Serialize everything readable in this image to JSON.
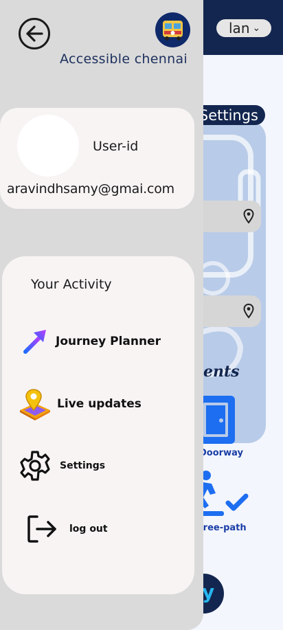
{
  "header": {
    "language_label": "lan",
    "language_chevron": "chevron-down-icon"
  },
  "background": {
    "settings_label": "Settings",
    "events_label": "ents",
    "doorway_label": "Doorway",
    "free_path_label": "free-path",
    "round_button_label": "y"
  },
  "drawer": {
    "app_name": "Accessible chennai",
    "back_icon": "arrow-left-circle-icon",
    "logo_icon": "bus-logo-icon",
    "profile": {
      "user_id": "User-id",
      "email": "aravindhsamy@gmai.com"
    },
    "activity": {
      "title": "Your Activity",
      "items": [
        {
          "label": "Journey Planner",
          "icon": "arrow-up-right-icon"
        },
        {
          "label": "Live updates",
          "icon": "map-pin-icon"
        },
        {
          "label": "Settings",
          "icon": "gear-icon"
        },
        {
          "label": "log out",
          "icon": "logout-icon"
        }
      ]
    }
  },
  "colors": {
    "navy": "#13264f",
    "drawer_bg": "#dadada",
    "card_bg": "#f8f4f4",
    "accent_blue": "#1b3ea6",
    "pin_yellow": "#f4c20d"
  }
}
